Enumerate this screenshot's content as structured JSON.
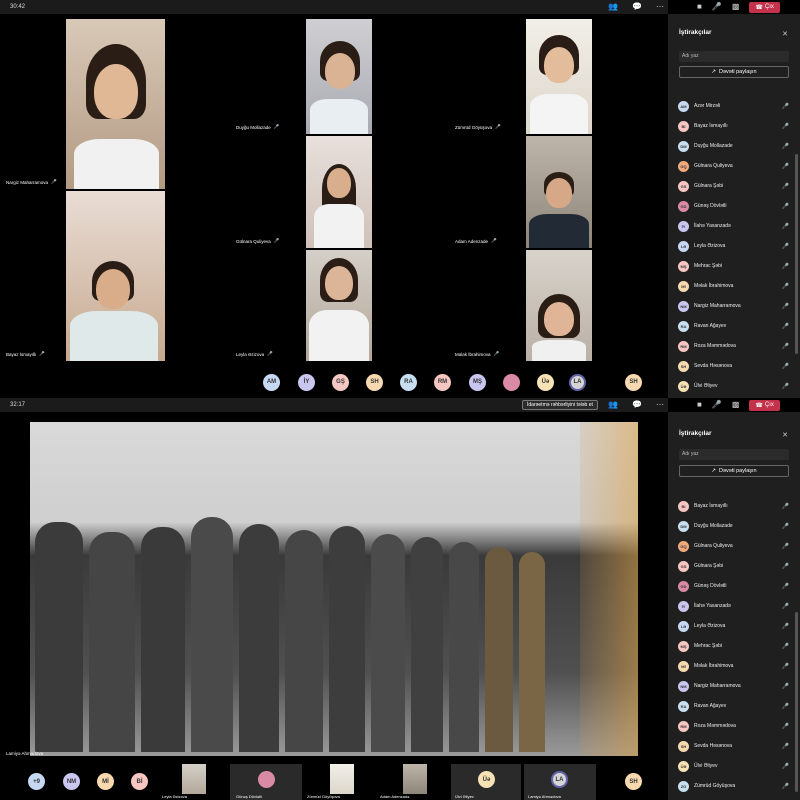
{
  "top": {
    "time": "30:42",
    "leave_label": "Çıx"
  },
  "top_tiles": [
    {
      "name": "Nargiz Maharramova"
    },
    {
      "name": "Duyğu Mollazade"
    },
    {
      "name": "Zümrüd Göyüşova"
    },
    {
      "name": "Bayaz İsmayıllı"
    },
    {
      "name": "Gülnara Quliyeva"
    },
    {
      "name": "Adam Adenzade"
    },
    {
      "name": "Leyla Əzizova"
    },
    {
      "name": "Malak İbrahimova"
    }
  ],
  "top_avatars": [
    {
      "initials": "AM",
      "color": "#c7d8f2"
    },
    {
      "initials": "İY",
      "color": "#c9c6f0"
    },
    {
      "initials": "GŞ",
      "color": "#f6c6c2"
    },
    {
      "initials": "SH",
      "color": "#f7d9b0"
    },
    {
      "initials": "RA",
      "color": "#c7dff0"
    },
    {
      "initials": "RM",
      "color": "#f6c6c2"
    },
    {
      "initials": "MŞ",
      "color": "#c9c6f0"
    },
    {
      "initials": "",
      "color": "#d98aa5"
    },
    {
      "initials": "Üə",
      "color": "#f7e2b5"
    },
    {
      "initials": "LA",
      "color": "#d5d5d5"
    },
    {
      "initials": "SH",
      "color": "#f7d9b0"
    }
  ],
  "panel_top": {
    "title": "İştirakçılar",
    "search_placeholder": "Adı yaz",
    "share_label": "Dəvəti paylaşın",
    "participants": [
      {
        "initials": "AM",
        "name": "Azər Mirzəli",
        "color": "#c7d8f2"
      },
      {
        "initials": "BI",
        "name": "Bayaz İsmayıllı",
        "color": "#f6c6c2"
      },
      {
        "initials": "DM",
        "name": "Duyğu Mollazade",
        "color": "#c7dff0"
      },
      {
        "initials": "GQ",
        "name": "Gülnara Quliyeva",
        "color": "#f0a87c"
      },
      {
        "initials": "GS",
        "name": "Gülnara Şəbi",
        "color": "#f6c6c2"
      },
      {
        "initials": "GD",
        "name": "Günəş Dövlətli",
        "color": "#d98aa5"
      },
      {
        "initials": "İY",
        "name": "İlahə Yaxanzadə",
        "color": "#c9c6f0"
      },
      {
        "initials": "LƏ",
        "name": "Leyla Əzizova",
        "color": "#c7d8f2"
      },
      {
        "initials": "MŞ",
        "name": "Mehrac Şəbi",
        "color": "#f6c6c2"
      },
      {
        "initials": "Mİ",
        "name": "Məlak İbrahimova",
        "color": "#f7d9b0"
      },
      {
        "initials": "NM",
        "name": "Nargiz Maharramova",
        "color": "#c9c6f0"
      },
      {
        "initials": "RA",
        "name": "Ravan Ağayev",
        "color": "#c7dff0"
      },
      {
        "initials": "RM",
        "name": "Roza Məmmədova",
        "color": "#f6c6c2"
      },
      {
        "initials": "SH",
        "name": "Sevda Həsənova",
        "color": "#f7d9b0"
      },
      {
        "initials": "ÜƏ",
        "name": "Ülvi Əliyev",
        "color": "#f7e2b5"
      }
    ]
  },
  "bottom": {
    "time": "32:17",
    "share_request": "İdarəetmə rəhbərliyini tələb et",
    "leave_label": "Çıx",
    "presenter": "Lamiyə Ahmədova"
  },
  "bottom_strip": [
    {
      "kind": "count",
      "label": "+9",
      "color": "#c7d8f2"
    },
    {
      "kind": "avatar",
      "label": "NM",
      "color": "#c9c6f0"
    },
    {
      "kind": "avatar",
      "label": "Mİ",
      "color": "#f7d9b0"
    },
    {
      "kind": "avatar",
      "label": "Bİ",
      "color": "#f6c6c2"
    },
    {
      "kind": "video",
      "label": "Leyla Əzizova"
    },
    {
      "kind": "avatar-tile",
      "label": "Günəş Dövlətli",
      "color": "#d98aa5"
    },
    {
      "kind": "video",
      "label": "Zümrüd Göyüşova"
    },
    {
      "kind": "video",
      "label": "Adam Adenzadə"
    },
    {
      "kind": "avatar-tile",
      "label": "Ülvi Əliyev",
      "initials": "Üə",
      "color": "#f7e2b5"
    },
    {
      "kind": "avatar-tile-active",
      "label": "Lamiyə Ahmədova",
      "initials": "LA",
      "color": "#d5d5d5"
    },
    {
      "kind": "avatar",
      "label": "SH",
      "color": "#f7d9b0"
    }
  ],
  "panel_bottom": {
    "title": "İştirakçılar",
    "search_placeholder": "Adı yaz",
    "share_label": "Dəvəti paylaşın",
    "participants": [
      {
        "initials": "BI",
        "name": "Bayaz İsmayıllı",
        "color": "#f6c6c2"
      },
      {
        "initials": "DM",
        "name": "Duyğu Mollazade",
        "color": "#c7dff0"
      },
      {
        "initials": "GQ",
        "name": "Gülnara Quliyeva",
        "color": "#f0a87c"
      },
      {
        "initials": "GS",
        "name": "Gülnara Şəbi",
        "color": "#f6c6c2"
      },
      {
        "initials": "GD",
        "name": "Günəş Dövlətli",
        "color": "#d98aa5"
      },
      {
        "initials": "İY",
        "name": "İlahə Yaxanzadə",
        "color": "#c9c6f0"
      },
      {
        "initials": "LƏ",
        "name": "Leyla Əzizova",
        "color": "#c7d8f2"
      },
      {
        "initials": "MŞ",
        "name": "Mehrac Şəbi",
        "color": "#f6c6c2"
      },
      {
        "initials": "Mİ",
        "name": "Məlak İbrahimova",
        "color": "#f7d9b0"
      },
      {
        "initials": "NM",
        "name": "Nargiz Maharramova",
        "color": "#c9c6f0"
      },
      {
        "initials": "RA",
        "name": "Ravan Ağayev",
        "color": "#c7dff0"
      },
      {
        "initials": "RM",
        "name": "Roza Məmmədova",
        "color": "#f6c6c2"
      },
      {
        "initials": "SH",
        "name": "Sevda Həsənova",
        "color": "#f7d9b0"
      },
      {
        "initials": "ÜƏ",
        "name": "Ülvi Əliyev",
        "color": "#f7e2b5"
      },
      {
        "initials": "ZG",
        "name": "Zümrüd Göyüşova",
        "color": "#c7dff0"
      }
    ]
  }
}
